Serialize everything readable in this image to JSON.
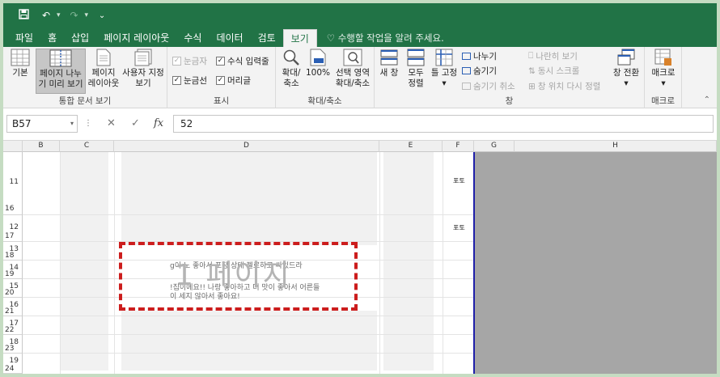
{
  "qat": {
    "save_icon": "save-icon",
    "undo_icon": "undo-icon",
    "redo_icon": "redo-icon"
  },
  "tabs": [
    {
      "label": "파일"
    },
    {
      "label": "홈"
    },
    {
      "label": "삽입"
    },
    {
      "label": "페이지 레이아웃"
    },
    {
      "label": "수식"
    },
    {
      "label": "데이터"
    },
    {
      "label": "검토"
    },
    {
      "label": "보기",
      "active": true
    }
  ],
  "tell_me": "수행할 작업을 알려 주세요.",
  "ribbon": {
    "workbook_views": {
      "label": "통합 문서 보기",
      "normal": "기본",
      "page_break_1": "페이지 나누",
      "page_break_2": "기 미리 보기",
      "page_layout_1": "페이지",
      "page_layout_2": "레이아웃",
      "custom_1": "사용자 지정",
      "custom_2": "보기"
    },
    "show": {
      "label": "표시",
      "ruler": "눈금자",
      "formula_bar": "수식 입력줄",
      "gridlines": "눈금선",
      "headings": "머리글"
    },
    "zoom": {
      "label": "확대/축소",
      "zoom_1": "확대/",
      "zoom_2": "축소",
      "hundred": "100%",
      "sel_1": "선택 영역",
      "sel_2": "확대/축소"
    },
    "window": {
      "label": "창",
      "new_window": "새 창",
      "arrange_1": "모두",
      "arrange_2": "정렬",
      "freeze_1": "틀 고정",
      "split": "나누기",
      "hide": "숨기기",
      "unhide": "숨기기 취소",
      "side_by_side": "나란히 보기",
      "sync_scroll": "동시 스크롤",
      "reset_pos": "창 위치 다시 정렬",
      "switch": "창 전환"
    },
    "macros": {
      "label": "매크로",
      "macro": "매크로"
    }
  },
  "formula_bar": {
    "name_box": "B57",
    "cancel": "✕",
    "enter": "✓",
    "fx": "fx",
    "value": "52"
  },
  "grid": {
    "columns": [
      "B",
      "C",
      "D",
      "E",
      "F",
      "G",
      "H"
    ],
    "rows": [
      {
        "num_top": "11",
        "num_bot": "16"
      },
      {
        "num_top": "12",
        "num_bot": "17"
      },
      {
        "num_top": "13",
        "num_bot": "18"
      },
      {
        "num_top": "14",
        "num_bot": "19"
      },
      {
        "num_top": "15",
        "num_bot": "20"
      },
      {
        "num_top": "16",
        "num_bot": "21"
      },
      {
        "num_top": "17",
        "num_bot": "22"
      },
      {
        "num_top": "18",
        "num_bot": "23"
      },
      {
        "num_top": "19",
        "num_bot": "24"
      }
    ],
    "f_cells": [
      "포토",
      "포토"
    ],
    "watermark": "1 페이지",
    "ghost_lines": [
      "g이 노 좋아서 포장 상태 젤로하고 싸있드라",
      "!집이에요!! 나랑 좋아하고 더 맛이 좋아서 어른들",
      "이 세지 않아서 좋아요!"
    ],
    "bg_color": "#a6a6a6",
    "break_color": "#1f1fa8",
    "highlight_color": "#cc1d1d"
  }
}
